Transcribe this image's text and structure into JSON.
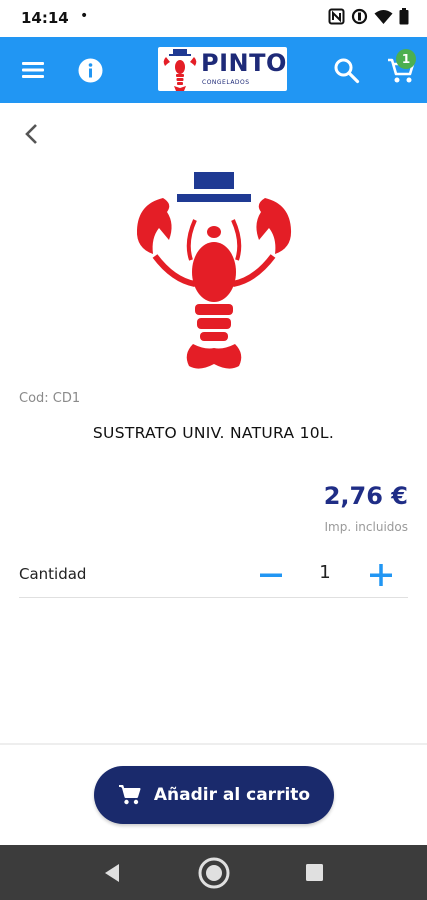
{
  "status_bar": {
    "time": "14:14",
    "dot": "•",
    "icons": [
      "nfc-icon",
      "data-saver-icon",
      "wifi-icon",
      "battery-icon"
    ]
  },
  "app_bar": {
    "color": "#2196f3",
    "logo": {
      "word": "PINTO",
      "subtitle": "CONGELADOS"
    },
    "cart_count": "1",
    "badge_color": "#4caf50"
  },
  "product": {
    "code": "Cod: CD1",
    "name": "SUSTRATO UNIV. NATURA 10L.",
    "price": "2,76 €",
    "tax_note": "Imp. incluidos",
    "image_icon": "lobster-logo-icon",
    "image_colors": {
      "lobster": "#e41e26",
      "hat": "#1f3a93"
    }
  },
  "quantity": {
    "label": "Cantidad",
    "value": "1",
    "accent": "#2196f3"
  },
  "actions": {
    "add_to_cart_label": "Añadir al carrito",
    "button_color": "#1a2a6c"
  },
  "nav_bar": {
    "icons": [
      "back-triangle-icon",
      "home-circle-icon",
      "recents-square-icon"
    ]
  }
}
